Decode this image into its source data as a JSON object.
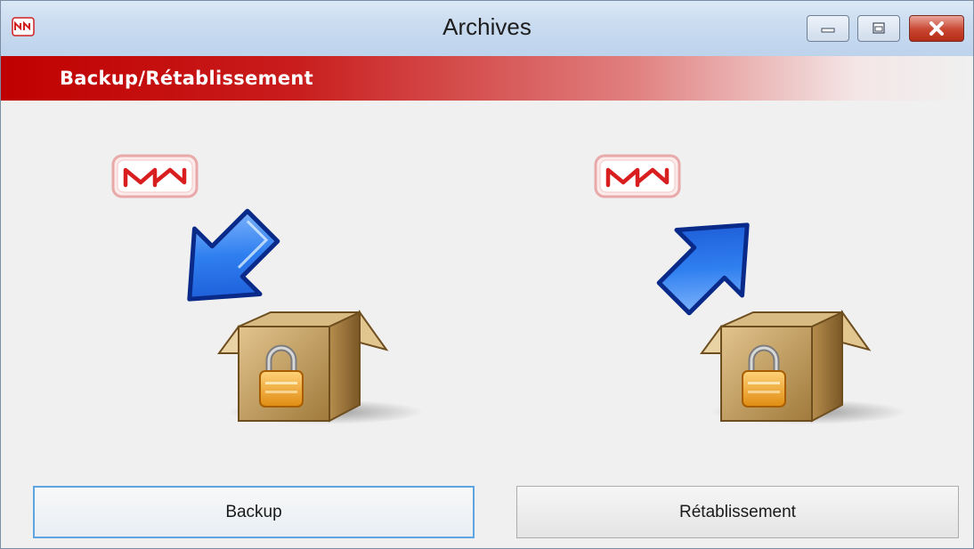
{
  "window": {
    "title": "Archives",
    "controls": [
      "minimize",
      "maximize",
      "close"
    ]
  },
  "banner": {
    "title": "Backup/Rétablissement"
  },
  "illustrations": {
    "backup": {
      "icons": [
        "nn-logo-icon",
        "arrow-down-right-icon",
        "locked-box-icon"
      ]
    },
    "restore": {
      "icons": [
        "nn-logo-icon",
        "arrow-up-left-icon",
        "locked-box-icon"
      ]
    }
  },
  "buttons": {
    "backup_label": "Backup",
    "restore_label": "Rétablissement"
  },
  "colors": {
    "banner_red": "#c00000",
    "arrow_blue": "#1f6fe0",
    "box_tan": "#c9a76a",
    "focus_border": "#5ea4e0"
  }
}
